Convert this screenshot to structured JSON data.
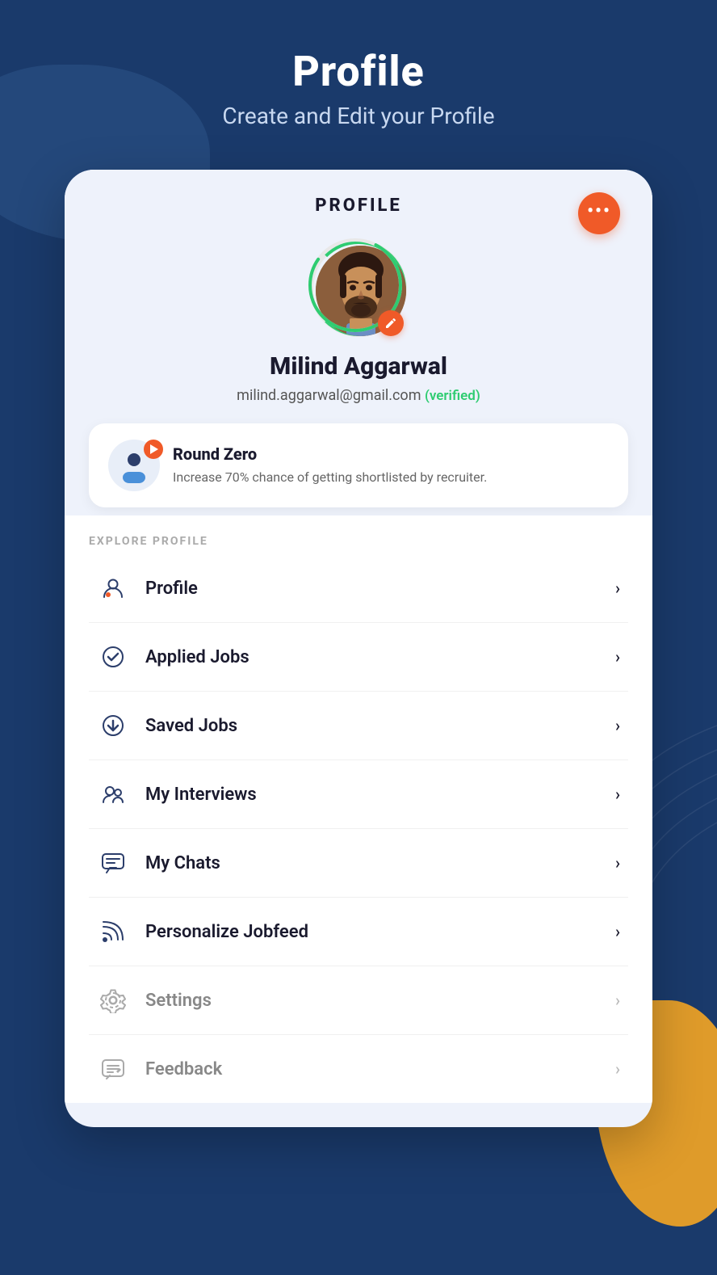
{
  "header": {
    "title": "Profile",
    "subtitle": "Create and Edit your Profile"
  },
  "card": {
    "title": "PROFILE",
    "more_btn_label": "···"
  },
  "user": {
    "name": "Milind Aggarwal",
    "email": "milind.aggarwal@gmail.com",
    "verified_label": "(verified)"
  },
  "round_zero": {
    "title": "Round Zero",
    "description": "Increase 70% chance of getting shortlisted by recruiter."
  },
  "explore_section": {
    "label": "EXPLORE PROFILE"
  },
  "menu_items": [
    {
      "id": "profile",
      "label": "Profile",
      "muted": false
    },
    {
      "id": "applied-jobs",
      "label": "Applied Jobs",
      "muted": false
    },
    {
      "id": "saved-jobs",
      "label": "Saved Jobs",
      "muted": false
    },
    {
      "id": "my-interviews",
      "label": "My Interviews",
      "muted": false
    },
    {
      "id": "my-chats",
      "label": "My Chats",
      "muted": false
    },
    {
      "id": "personalize-jobfeed",
      "label": "Personalize Jobfeed",
      "muted": false
    },
    {
      "id": "settings",
      "label": "Settings",
      "muted": true
    },
    {
      "id": "feedback",
      "label": "Feedback",
      "muted": true
    }
  ]
}
